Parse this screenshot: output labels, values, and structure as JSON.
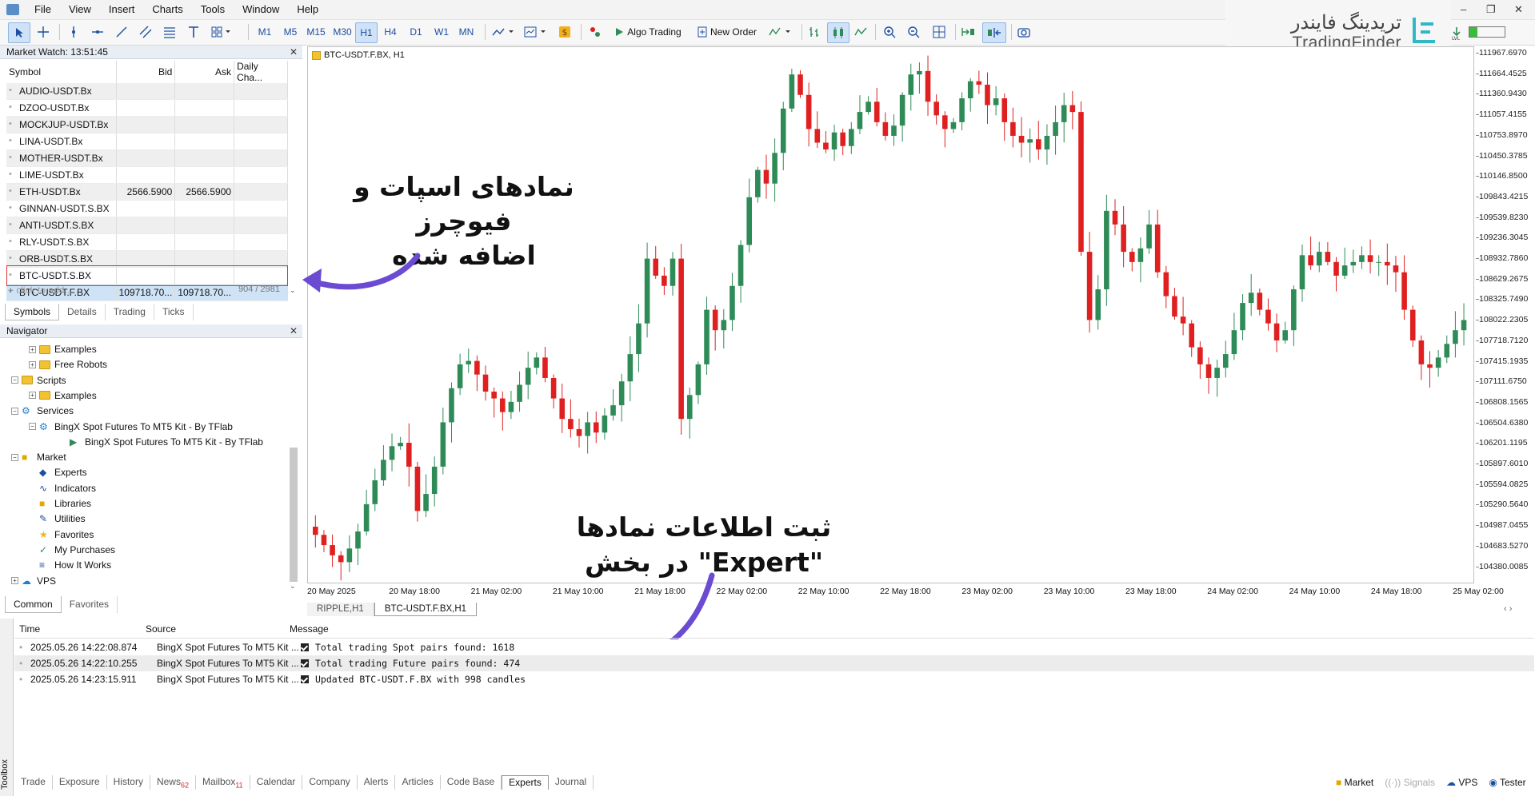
{
  "menu": [
    "File",
    "View",
    "Insert",
    "Charts",
    "Tools",
    "Window",
    "Help"
  ],
  "toolbar": {
    "timeframes": [
      "M1",
      "M5",
      "M15",
      "M30",
      "H1",
      "H4",
      "D1",
      "W1",
      "MN"
    ],
    "active_timeframe": "H1",
    "algo_trading": "Algo Trading",
    "new_order": "New Order"
  },
  "logo": {
    "fa": "تریدینگ فایندر",
    "en": "TradingFinder"
  },
  "market_watch": {
    "title": "Market Watch: 13:51:45",
    "columns": [
      "Symbol",
      "Bid",
      "Ask",
      "Daily Cha..."
    ],
    "rows": [
      {
        "symbol": "AUDIO-USDT.Bx",
        "bid": "",
        "ask": "",
        "change": ""
      },
      {
        "symbol": "DZOO-USDT.Bx",
        "bid": "",
        "ask": "",
        "change": ""
      },
      {
        "symbol": "MOCKJUP-USDT.Bx",
        "bid": "",
        "ask": "",
        "change": ""
      },
      {
        "symbol": "LINA-USDT.Bx",
        "bid": "",
        "ask": "",
        "change": ""
      },
      {
        "symbol": "MOTHER-USDT.Bx",
        "bid": "",
        "ask": "",
        "change": ""
      },
      {
        "symbol": "LIME-USDT.Bx",
        "bid": "",
        "ask": "",
        "change": ""
      },
      {
        "symbol": "ETH-USDT.Bx",
        "bid": "2566.5900",
        "ask": "2566.5900",
        "change": ""
      },
      {
        "symbol": "GINNAN-USDT.S.BX",
        "bid": "",
        "ask": "",
        "change": ""
      },
      {
        "symbol": "ANTI-USDT.S.BX",
        "bid": "",
        "ask": "",
        "change": ""
      },
      {
        "symbol": "RLY-USDT.S.BX",
        "bid": "",
        "ask": "",
        "change": ""
      },
      {
        "symbol": "ORB-USDT.S.BX",
        "bid": "",
        "ask": "",
        "change": ""
      },
      {
        "symbol": "BTC-USDT.S.BX",
        "bid": "",
        "ask": "",
        "change": ""
      },
      {
        "symbol": "BTC-USDT.F.BX",
        "bid": "109718.70...",
        "ask": "109718.70...",
        "change": ""
      }
    ],
    "add_placeholder": "click to add...",
    "count": "904 / 2981",
    "tabs": [
      "Symbols",
      "Details",
      "Trading",
      "Ticks"
    ]
  },
  "navigator": {
    "title": "Navigator",
    "items": [
      {
        "label": "Examples",
        "icon": "folder-icon"
      },
      {
        "label": "Free Robots",
        "icon": "folder-icon"
      },
      {
        "label": "Scripts",
        "icon": "folder-icon"
      },
      {
        "label": "Examples",
        "icon": "folder-icon"
      },
      {
        "label": "Services",
        "icon": "gear-icon"
      },
      {
        "label": "BingX Spot Futures To MT5 Kit - By TFlab",
        "icon": "gear-icon"
      },
      {
        "label": "BingX Spot Futures To MT5 Kit - By TFlab",
        "icon": "play-icon"
      },
      {
        "label": "Market",
        "icon": "bag-icon"
      },
      {
        "label": "Experts",
        "icon": "expert-icon"
      },
      {
        "label": "Indicators",
        "icon": "indicator-icon"
      },
      {
        "label": "Libraries",
        "icon": "library-icon"
      },
      {
        "label": "Utilities",
        "icon": "utility-icon"
      },
      {
        "label": "Favorites",
        "icon": "star-icon"
      },
      {
        "label": "My Purchases",
        "icon": "check-icon"
      },
      {
        "label": "How It Works",
        "icon": "list-icon"
      },
      {
        "label": "VPS",
        "icon": "cloud-icon"
      }
    ],
    "tabs": [
      "Common",
      "Favorites"
    ]
  },
  "chart": {
    "title": "BTC-USDT.F.BX, H1",
    "tabs": [
      "RIPPLE,H1",
      "BTC-USDT.F.BX,H1"
    ],
    "active_tab": "BTC-USDT.F.BX,H1",
    "colors": {
      "bull": "#2e8b57",
      "bear": "#e02020"
    }
  },
  "chart_data": {
    "type": "candlestick",
    "price_ticks": [
      "111967.6970",
      "111664.4525",
      "111360.9430",
      "111057.4155",
      "110753.8970",
      "110450.3785",
      "110146.8500",
      "109843.4215",
      "109539.8230",
      "109236.3045",
      "108932.7860",
      "108629.2675",
      "108325.7490",
      "108022.2305",
      "107718.7120",
      "107415.1935",
      "107111.6750",
      "106808.1565",
      "106504.6380",
      "106201.1195",
      "105897.6010",
      "105594.0825",
      "105290.5640",
      "104987.0455",
      "104683.5270",
      "104380.0085"
    ],
    "time_ticks": [
      "20 May 2025",
      "20 May 18:00",
      "21 May 02:00",
      "21 May 10:00",
      "21 May 18:00",
      "22 May 02:00",
      "22 May 10:00",
      "22 May 18:00",
      "23 May 02:00",
      "23 May 10:00",
      "23 May 18:00",
      "24 May 02:00",
      "24 May 10:00",
      "24 May 18:00",
      "25 May 02:00"
    ],
    "ylim": [
      104200,
      112050
    ],
    "closes": [
      104900,
      104750,
      104600,
      104500,
      104700,
      104950,
      105350,
      105700,
      106000,
      106200,
      106250,
      105900,
      105250,
      105500,
      105900,
      106550,
      107050,
      107400,
      107450,
      107250,
      107000,
      106900,
      106700,
      106850,
      107100,
      107350,
      107500,
      107200,
      106900,
      106600,
      106450,
      106350,
      106550,
      106400,
      106650,
      106800,
      107150,
      107550,
      108000,
      108950,
      108700,
      108550,
      108950,
      106600,
      106950,
      107400,
      108200,
      107900,
      108050,
      108550,
      109150,
      109850,
      110250,
      110050,
      110500,
      111150,
      111650,
      111350,
      110850,
      110650,
      110550,
      110800,
      110600,
      110850,
      111100,
      111250,
      110950,
      110750,
      110900,
      111350,
      111650,
      111700,
      111250,
      111050,
      110850,
      110950,
      111300,
      111550,
      111500,
      111200,
      111300,
      110950,
      110750,
      110650,
      110700,
      110550,
      110750,
      110950,
      111200,
      111100,
      109050,
      108050,
      108500,
      109650,
      109450,
      109050,
      108900,
      109100,
      109450,
      108750,
      108400,
      108100,
      108000,
      107650,
      107400,
      107200,
      107350,
      107550,
      107900,
      108300,
      108450,
      108200,
      108000,
      107750,
      107900,
      108500,
      109000,
      108850,
      109050,
      108900,
      108700,
      108850,
      108900,
      109000,
      108900,
      108900,
      108850,
      108750,
      108200,
      107750,
      107400,
      107350,
      107500,
      107700,
      107900,
      108050
    ]
  },
  "annotations": {
    "top": "نمادهای اسپات و فیوچرز\nاضافه شده",
    "bottom": "ثبت اطلاعات نمادها\n\"Expert\" در بخش"
  },
  "toolbox": {
    "label": "Toolbox",
    "columns": [
      "Time",
      "Source",
      "Message"
    ],
    "rows": [
      {
        "time": "2025.05.26 14:22:08.874",
        "source": "BingX Spot Futures To MT5 Kit ...",
        "message": "Total trading Spot pairs found: 1618"
      },
      {
        "time": "2025.05.26 14:22:10.255",
        "source": "BingX Spot Futures To MT5 Kit ...",
        "message": "Total trading Future pairs found: 474"
      },
      {
        "time": "2025.05.26 14:23:15.911",
        "source": "BingX Spot Futures To MT5 Kit ...",
        "message": "Updated BTC-USDT.F.BX with 998 candles"
      }
    ],
    "tabs": [
      {
        "label": "Trade",
        "badge": ""
      },
      {
        "label": "Exposure",
        "badge": ""
      },
      {
        "label": "History",
        "badge": ""
      },
      {
        "label": "News",
        "badge": "62"
      },
      {
        "label": "Mailbox",
        "badge": "11"
      },
      {
        "label": "Calendar",
        "badge": ""
      },
      {
        "label": "Company",
        "badge": ""
      },
      {
        "label": "Alerts",
        "badge": ""
      },
      {
        "label": "Articles",
        "badge": ""
      },
      {
        "label": "Code Base",
        "badge": ""
      },
      {
        "label": "Experts",
        "badge": ""
      },
      {
        "label": "Journal",
        "badge": ""
      }
    ],
    "active_tab": "Experts",
    "status": [
      "Market",
      "Signals",
      "VPS",
      "Tester"
    ]
  }
}
